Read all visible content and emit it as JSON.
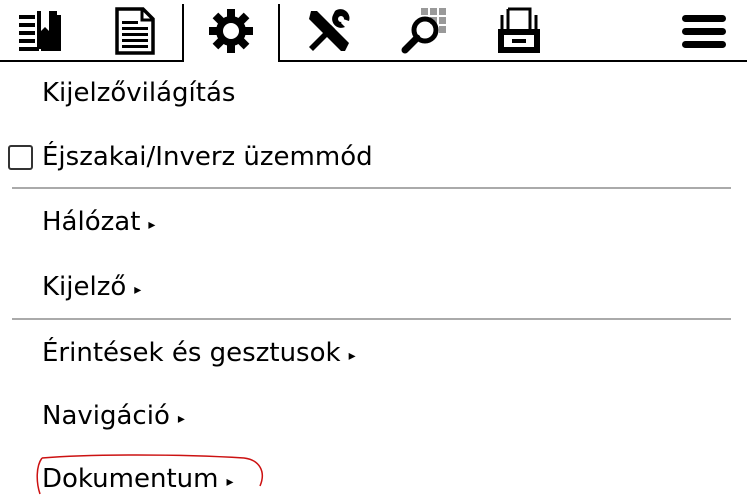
{
  "tabs": [
    {
      "icon": "bookmarks-icon",
      "active": false
    },
    {
      "icon": "document-icon",
      "active": false
    },
    {
      "icon": "gear-icon",
      "active": true
    },
    {
      "icon": "tools-icon",
      "active": false
    },
    {
      "icon": "search-icon",
      "active": false
    },
    {
      "icon": "filebrowser-icon",
      "active": false
    },
    {
      "icon": "hamburger-menu-icon",
      "active": false
    }
  ],
  "menu": {
    "frontlight_label": "Kijelzővilágítás",
    "night_mode_label": "Éjszakai/Inverz üzemmód",
    "night_mode_checked": false,
    "network_label": "Hálózat",
    "screen_label": "Kijelző",
    "taps_gestures_label": "Érintések és gesztusok",
    "navigation_label": "Navigáció",
    "document_label": "Dokumentum",
    "submenu_arrow": "▸"
  },
  "colors": {
    "separator": "#aaaaaa",
    "annotation_ink": "#cc1111",
    "foreground": "#000000"
  }
}
